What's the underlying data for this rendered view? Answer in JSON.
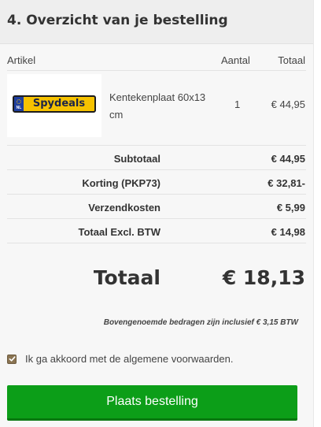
{
  "section": {
    "title": "4. Overzicht van je bestelling"
  },
  "table": {
    "headers": {
      "article": "Artikel",
      "quantity": "Aantal",
      "total": "Totaal"
    },
    "items": [
      {
        "logo_text": "Spydeals",
        "logo_country": "NL",
        "name": "Kentekenplaat 60x13 cm",
        "quantity": "1",
        "total": "€ 44,95"
      }
    ]
  },
  "summary": [
    {
      "label": "Subtotaal",
      "value": "€ 44,95"
    },
    {
      "label": "Korting (PKP73)",
      "value": "€ 32,81-"
    },
    {
      "label": "Verzendkosten",
      "value": "€ 5,99"
    },
    {
      "label": "Totaal Excl. BTW",
      "value": "€ 14,98"
    }
  ],
  "grand_total": {
    "label": "Totaal",
    "value": "€ 18,13"
  },
  "vat_note": "Bovengenoemde bedragen zijn inclusief € 3,15 BTW",
  "terms": {
    "label": "Ik ga akkoord met de algemene voorwaarden.",
    "checked": true
  },
  "place_order": {
    "label": "Plaats bestelling"
  },
  "colors": {
    "button": "#0c9e18",
    "checkbox": "#8a7452",
    "plate_yellow": "#f6c200",
    "plate_blue": "#1f3f9e"
  }
}
